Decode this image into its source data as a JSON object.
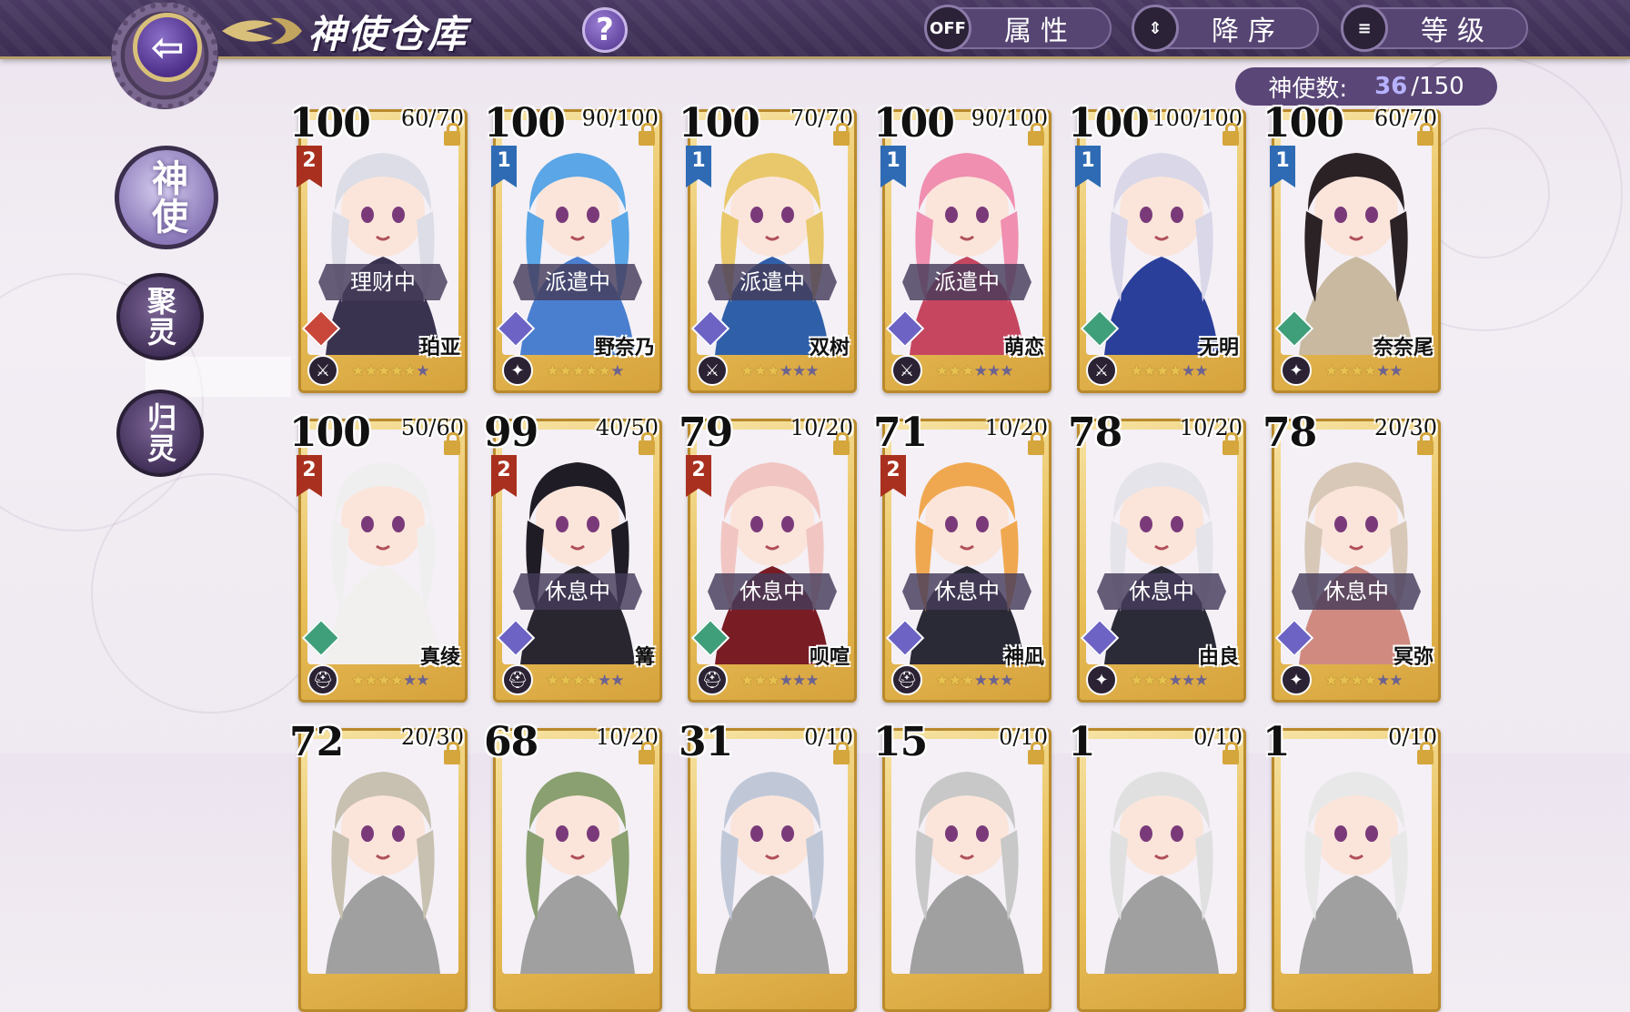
{
  "header": {
    "back_icon": "arrow-left-icon",
    "title": "神使仓库",
    "help_label": "?",
    "filter_toggle": "OFF",
    "filter_label": "属性",
    "sort_label": "降序",
    "sort_icon": "sort-up-down-icon",
    "sort_field_label": "等级",
    "sort_field_icon": "list-lines-icon"
  },
  "count": {
    "label": "神使数:",
    "current": "36",
    "max": "/150"
  },
  "side_nav": {
    "items": [
      {
        "label": "神使",
        "active": true
      },
      {
        "label": "聚灵",
        "active": false
      },
      {
        "label": "归灵",
        "active": false
      }
    ]
  },
  "colors": {
    "accent_purple": "#4a3a63",
    "card_gold": "#e9bf58",
    "rank1_blue": "#2e6bb4",
    "rank2_red": "#a9301f",
    "element_fire": "#c9463a",
    "element_ice": "#6d63c5",
    "element_wind": "#3f9f7a"
  },
  "cards": [
    {
      "level": "100",
      "cap": "60/70",
      "rank": "2",
      "status": "理财中",
      "element": "fire",
      "name": "珀亚",
      "stars_on": 5,
      "stars_total": 6,
      "weapon": "sword-icon"
    },
    {
      "level": "100",
      "cap": "90/100",
      "rank": "1",
      "status": "派遣中",
      "element": "ice",
      "name": "野奈乃",
      "stars_on": 5,
      "stars_total": 6,
      "weapon": "claw-icon"
    },
    {
      "level": "100",
      "cap": "70/70",
      "rank": "1",
      "status": "派遣中",
      "element": "ice",
      "name": "双树",
      "stars_on": 3,
      "stars_total": 6,
      "weapon": "sword-icon"
    },
    {
      "level": "100",
      "cap": "90/100",
      "rank": "1",
      "status": "派遣中",
      "element": "ice",
      "name": "萌恋",
      "stars_on": 3,
      "stars_total": 6,
      "weapon": "sword-icon"
    },
    {
      "level": "100",
      "cap": "100/100",
      "rank": "1",
      "status": "",
      "element": "wind",
      "name": "无明",
      "stars_on": 4,
      "stars_total": 6,
      "weapon": "sword-icon"
    },
    {
      "level": "100",
      "cap": "60/70",
      "rank": "1",
      "status": "",
      "element": "wind",
      "name": "奈奈尾",
      "stars_on": 4,
      "stars_total": 6,
      "weapon": "claw-icon"
    },
    {
      "level": "100",
      "cap": "50/60",
      "rank": "2",
      "status": "",
      "element": "wind",
      "name": "真绫",
      "stars_on": 4,
      "stars_total": 6,
      "weapon": "helm-icon"
    },
    {
      "level": "99",
      "cap": "40/50",
      "rank": "2",
      "status": "休息中",
      "element": "ice",
      "name": "篝",
      "stars_on": 4,
      "stars_total": 6,
      "weapon": "helm-icon"
    },
    {
      "level": "79",
      "cap": "10/20",
      "rank": "2",
      "status": "休息中",
      "element": "wind",
      "name": "呗喧",
      "stars_on": 3,
      "stars_total": 6,
      "weapon": "helm-icon"
    },
    {
      "level": "71",
      "cap": "10/20",
      "rank": "2",
      "status": "休息中",
      "element": "ice",
      "name": "神凪",
      "stars_on": 3,
      "stars_total": 6,
      "weapon": "helm-icon"
    },
    {
      "level": "78",
      "cap": "10/20",
      "rank": "",
      "status": "休息中",
      "element": "ice",
      "name": "由良",
      "stars_on": 3,
      "stars_total": 6,
      "weapon": "claw-icon"
    },
    {
      "level": "78",
      "cap": "20/30",
      "rank": "",
      "status": "休息中",
      "element": "ice",
      "name": "冥弥",
      "stars_on": 4,
      "stars_total": 6,
      "weapon": "claw-icon"
    },
    {
      "level": "72",
      "cap": "20/30",
      "rank": "",
      "status": "",
      "element": "",
      "name": "",
      "stars_on": 0,
      "stars_total": 0,
      "weapon": ""
    },
    {
      "level": "68",
      "cap": "10/20",
      "rank": "",
      "status": "",
      "element": "",
      "name": "",
      "stars_on": 0,
      "stars_total": 0,
      "weapon": ""
    },
    {
      "level": "31",
      "cap": "0/10",
      "rank": "",
      "status": "",
      "element": "",
      "name": "",
      "stars_on": 0,
      "stars_total": 0,
      "weapon": ""
    },
    {
      "level": "15",
      "cap": "0/10",
      "rank": "",
      "status": "",
      "element": "",
      "name": "",
      "stars_on": 0,
      "stars_total": 0,
      "weapon": ""
    },
    {
      "level": "1",
      "cap": "0/10",
      "rank": "",
      "status": "",
      "element": "",
      "name": "",
      "stars_on": 0,
      "stars_total": 0,
      "weapon": ""
    },
    {
      "level": "1",
      "cap": "0/10",
      "rank": "",
      "status": "",
      "element": "",
      "name": "",
      "stars_on": 0,
      "stars_total": 0,
      "weapon": ""
    }
  ]
}
